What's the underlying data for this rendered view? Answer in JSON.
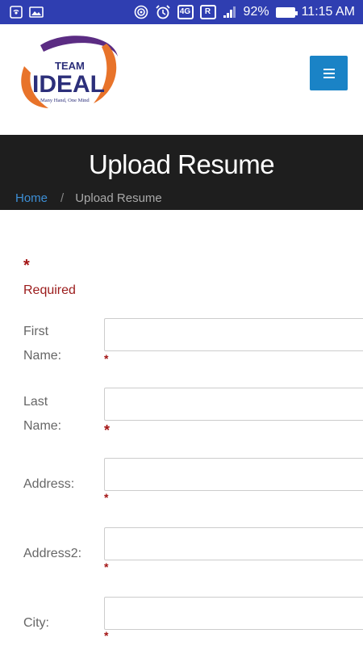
{
  "status_bar": {
    "battery": "92%",
    "time": "11:15 AM",
    "network": "4G",
    "roaming": "R",
    "icons": [
      "hotspot-icon",
      "image-icon",
      "wifi-icon",
      "alarm-icon",
      "signal-icon",
      "battery-icon"
    ]
  },
  "header": {
    "logo_top": "TEAM",
    "logo_main": "IDEAL",
    "logo_tagline": "Many Hand, One Mind",
    "menu_icon": "hamburger-icon",
    "accent_color": "#1a83c6"
  },
  "banner": {
    "title": "Upload Resume",
    "breadcrumb": {
      "home": "Home",
      "separator": "/",
      "current": "Upload Resume"
    }
  },
  "form": {
    "required_marker": "*",
    "required_text": "Required",
    "fields": [
      {
        "label_line1": "First",
        "label_line2": "Name:",
        "value": "",
        "required": "*"
      },
      {
        "label_line1": "Last",
        "label_line2": "Name:",
        "value": "",
        "required": "*"
      },
      {
        "label": "Address:",
        "value": "",
        "required": "*"
      },
      {
        "label": "Address2:",
        "value": "",
        "required": "*"
      },
      {
        "label": "City:",
        "value": "",
        "required": "*"
      }
    ]
  }
}
